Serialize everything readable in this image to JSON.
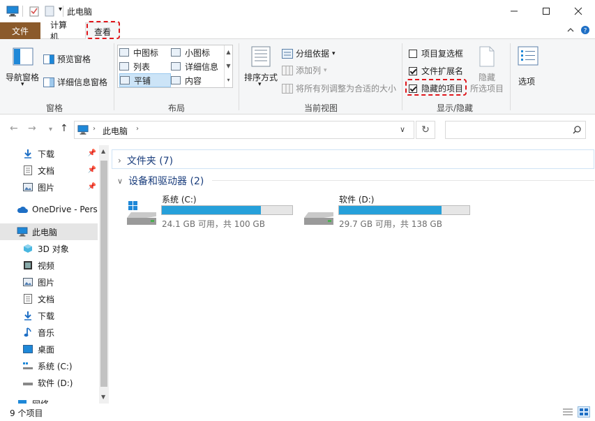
{
  "window": {
    "title": "此电脑"
  },
  "tabs": {
    "file": "文件",
    "computer": "计算机",
    "view": "查看"
  },
  "ribbon": {
    "panes": {
      "nav_pane": "导航窗格",
      "preview_pane": "预览窗格",
      "details_pane": "详细信息窗格",
      "label": "窗格"
    },
    "layout": {
      "items": [
        "中图标",
        "小图标",
        "列表",
        "详细信息",
        "平铺",
        "内容"
      ],
      "label": "布局"
    },
    "current_view": {
      "sort": "排序方式",
      "group_by": "分组依据",
      "add_columns": "添加列",
      "fit_columns": "将所有列调整为合适的大小",
      "label": "当前视图"
    },
    "show_hide": {
      "item_checkboxes": "项目复选框",
      "file_extensions": "文件扩展名",
      "hidden_items": "隐藏的项目",
      "hide_selected_line1": "隐藏",
      "hide_selected_line2": "所选项目",
      "label": "显示/隐藏"
    },
    "options": {
      "label": "选项"
    }
  },
  "address": {
    "path": "此电脑"
  },
  "sidebar": {
    "items": [
      {
        "label": "下载"
      },
      {
        "label": "文档"
      },
      {
        "label": "图片"
      },
      {
        "label": "OneDrive - Perso"
      },
      {
        "label": "此电脑"
      },
      {
        "label": "3D 对象"
      },
      {
        "label": "视频"
      },
      {
        "label": "图片"
      },
      {
        "label": "文档"
      },
      {
        "label": "下载"
      },
      {
        "label": "音乐"
      },
      {
        "label": "桌面"
      },
      {
        "label": "系统 (C:)"
      },
      {
        "label": "软件 (D:)"
      },
      {
        "label": "网络"
      }
    ]
  },
  "main": {
    "folders_section": "文件夹 (7)",
    "devices_section": "设备和驱动器 (2)",
    "drives": [
      {
        "name": "系统 (C:)",
        "free_text": "24.1 GB 可用，共 100 GB",
        "used_fraction": 0.759
      },
      {
        "name": "软件 (D:)",
        "free_text": "29.7 GB 可用，共 138 GB",
        "used_fraction": 0.785
      }
    ]
  },
  "status": {
    "count": "9 个项目"
  },
  "colors": {
    "accent": "#26a0da",
    "file_tab": "#8b5a2b",
    "highlight": "#e0161b"
  }
}
